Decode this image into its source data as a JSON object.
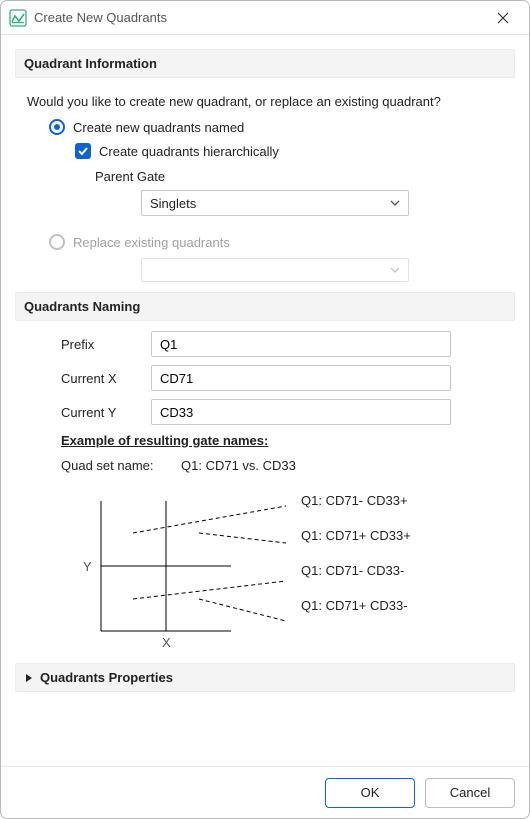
{
  "window": {
    "title": "Create New Quadrants"
  },
  "section1": {
    "header": "Quadrant Information",
    "question": "Would you like to create new quadrant, or replace an existing quadrant?",
    "opt_create": "Create new quadrants named",
    "chk_hier": "Create quadrants hierarchically",
    "parent_label": "Parent Gate",
    "parent_value": "Singlets",
    "opt_replace": "Replace existing quadrants"
  },
  "section2": {
    "header": "Quadrants Naming",
    "prefix_label": "Prefix",
    "prefix_value": "Q1",
    "curx_label": "Current X",
    "curx_value": "CD71",
    "cury_label": "Current Y",
    "cury_value": "CD33",
    "example_header": "Example of resulting gate names:",
    "quadset_label": "Quad set name:",
    "quadset_value": "Q1: CD71 vs. CD33",
    "axis_y": "Y",
    "axis_x": "X",
    "q_ul": "Q1: CD71- CD33+",
    "q_ur": "Q1: CD71+ CD33+",
    "q_ll": "Q1: CD71- CD33-",
    "q_lr": "Q1: CD71+ CD33-"
  },
  "section3": {
    "header": "Quadrants Properties"
  },
  "footer": {
    "ok": "OK",
    "cancel": "Cancel"
  }
}
